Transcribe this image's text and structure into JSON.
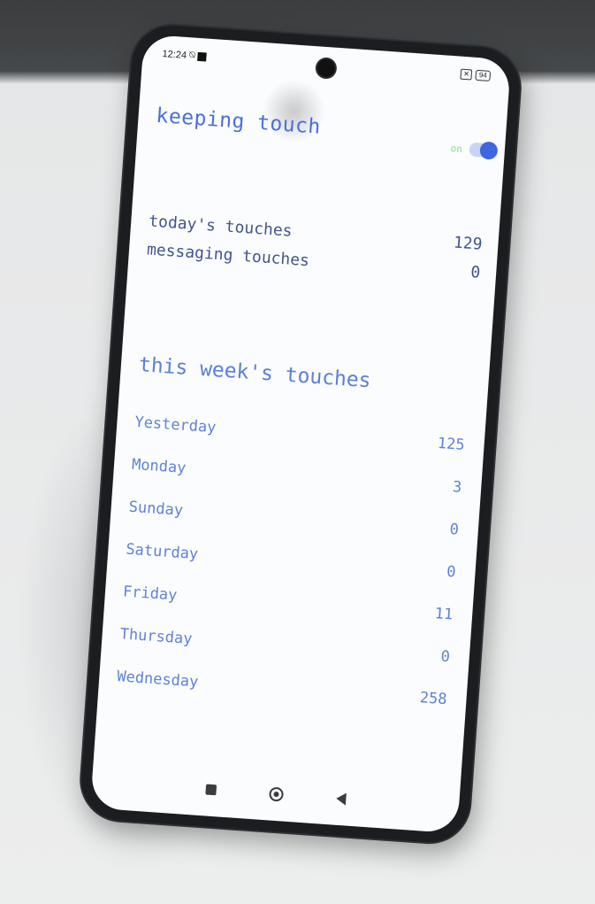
{
  "status_bar": {
    "time": "12:24",
    "silent_icon": "bell-off-icon",
    "battery": "94"
  },
  "app": {
    "title": "keeping touch",
    "toggle_label": "on",
    "toggle_state": true
  },
  "today": {
    "rows": [
      {
        "label": "today's touches",
        "value": "129"
      },
      {
        "label": "messaging touches",
        "value": "0"
      }
    ]
  },
  "week": {
    "heading": "this week's touches",
    "rows": [
      {
        "label": "Yesterday",
        "value": "125"
      },
      {
        "label": "Monday",
        "value": "3"
      },
      {
        "label": "Sunday",
        "value": "0"
      },
      {
        "label": "Saturday",
        "value": "0"
      },
      {
        "label": "Friday",
        "value": "11"
      },
      {
        "label": "Thursday",
        "value": "0"
      },
      {
        "label": "Wednesday",
        "value": "258"
      }
    ]
  },
  "colors": {
    "accent": "#3f66e0",
    "title": "#4b6fd8",
    "toggle_label": "#86e08a",
    "text": "#41558f"
  }
}
